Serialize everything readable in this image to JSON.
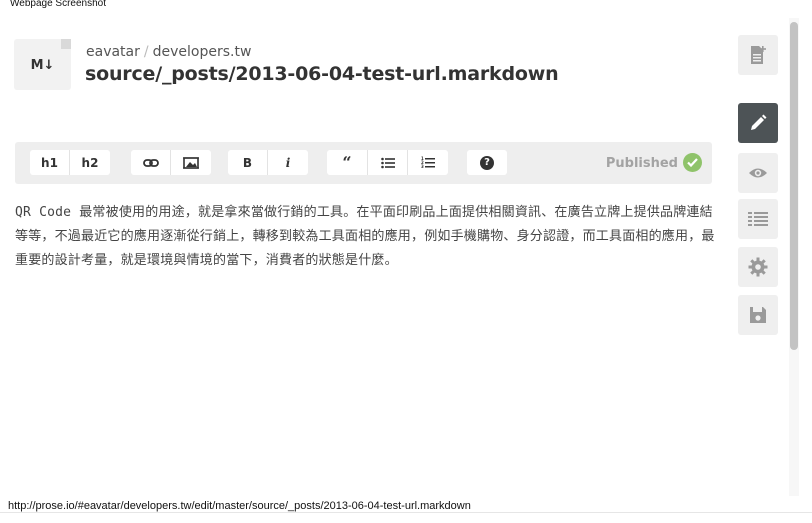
{
  "window": {
    "title": "Webpage Screenshot"
  },
  "header": {
    "badge": "M↓",
    "owner": "eavatar",
    "separator": "/",
    "repo": "developers.tw",
    "file_path": "source/_posts/2013-06-04-test-url.markdown"
  },
  "toolbar": {
    "h1": "h1",
    "h2": "h2",
    "bold": "B",
    "italic": "i",
    "quote": "“",
    "help": "?",
    "status": "Published"
  },
  "content": {
    "paragraph": "QR Code 最常被使用的用途，就是拿來當做行銷的工具。在平面印刷品上面提供相關資訊、在廣告立牌上提供品牌連結等等，不過最近它的應用逐漸從行銷上，轉移到較為工具面相的應用，例如手機購物、身分認證，而工具面相的應用，最重要的設計考量，就是環境與情境的當下，消費者的狀態是什麼。"
  },
  "sidebar": {
    "items": [
      {
        "icon": "new-file-icon"
      },
      {
        "icon": "pencil-icon",
        "active": true
      },
      {
        "icon": "eye-icon"
      },
      {
        "icon": "list-icon"
      },
      {
        "icon": "gear-icon"
      },
      {
        "icon": "save-icon"
      }
    ]
  },
  "status_bar": {
    "url": "http://prose.io/#eavatar/developers.tw/edit/master/source/_posts/2013-06-04-test-url.markdown"
  },
  "colors": {
    "active_sidebar": "#4d5356",
    "published_check": "#8fc36a",
    "toolbar_bg": "#eeeeee"
  }
}
